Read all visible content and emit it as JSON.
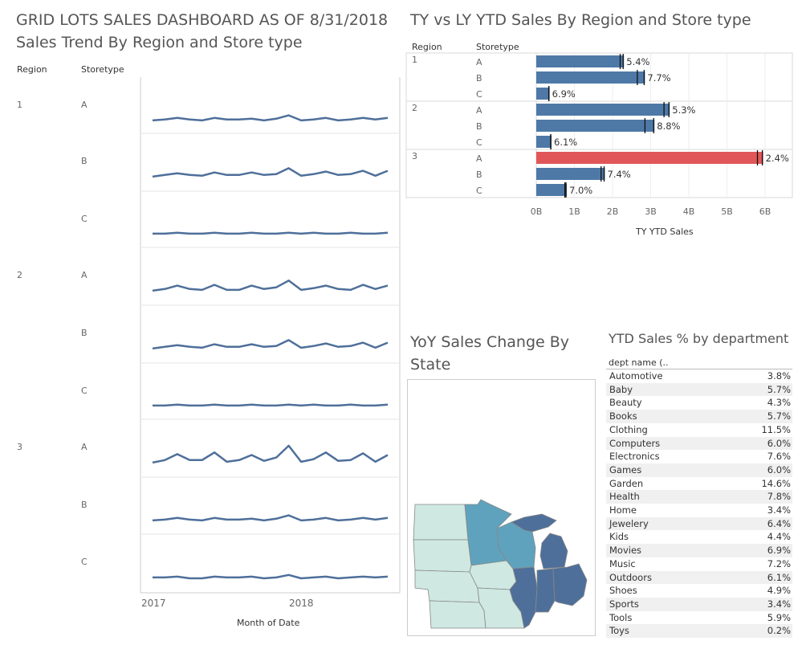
{
  "dashboard_title": "GRID LOTS SALES DASHBOARD AS OF 8/31/2018",
  "trend": {
    "title": "Sales Trend By Region and Store type",
    "region_header": "Region",
    "storetype_header": "Storetype",
    "xlabel": "Month of Date",
    "x_ticks": [
      "2017",
      "2018"
    ]
  },
  "ytd": {
    "title": "TY vs LY YTD Sales By Region and Store type",
    "region_header": "Region",
    "storetype_header": "Storetype",
    "xlabel": "TY YTD Sales",
    "x_ticks": [
      "0B",
      "1B",
      "2B",
      "3B",
      "4B",
      "5B",
      "6B"
    ]
  },
  "map": {
    "title": "YoY Sales Change By State"
  },
  "dept": {
    "title": "YTD Sales % by department",
    "column_header": "dept name (.."
  },
  "colors": {
    "bar": "#4e79a7",
    "highlight": "#e15759",
    "line": "#4e6f9a",
    "map_light": "#cfe8e1",
    "map_mid": "#5fa2bd",
    "map_dark": "#4e6f9a"
  },
  "chart_data": [
    {
      "type": "line",
      "title": "Sales Trend By Region and Store type",
      "xlabel": "Month of Date",
      "x_ticks": [
        "2017",
        "2018"
      ],
      "series": [
        {
          "region": "1",
          "storetype": "A",
          "values": [
            2,
            3,
            5,
            3,
            2,
            5,
            3,
            3,
            4,
            2,
            4,
            8,
            2,
            3,
            5,
            2,
            3,
            5,
            3,
            5
          ]
        },
        {
          "region": "1",
          "storetype": "B",
          "values": [
            2,
            4,
            6,
            4,
            3,
            7,
            4,
            4,
            7,
            4,
            5,
            12,
            3,
            5,
            8,
            4,
            5,
            9,
            3,
            9
          ]
        },
        {
          "region": "1",
          "storetype": "C",
          "values": [
            3,
            3,
            4,
            3,
            3,
            4,
            3,
            3,
            4,
            3,
            3,
            4,
            3,
            4,
            3,
            3,
            4,
            3,
            3,
            4
          ]
        },
        {
          "region": "2",
          "storetype": "A",
          "values": [
            2,
            4,
            8,
            4,
            3,
            9,
            3,
            3,
            8,
            4,
            6,
            14,
            3,
            5,
            8,
            4,
            3,
            9,
            4,
            8
          ]
        },
        {
          "region": "2",
          "storetype": "B",
          "values": [
            2,
            4,
            6,
            4,
            3,
            7,
            4,
            4,
            7,
            4,
            5,
            12,
            3,
            5,
            8,
            4,
            5,
            9,
            3,
            9
          ]
        },
        {
          "region": "2",
          "storetype": "C",
          "values": [
            3,
            3,
            4,
            3,
            3,
            4,
            3,
            3,
            4,
            3,
            3,
            4,
            3,
            4,
            3,
            3,
            4,
            3,
            3,
            4
          ]
        },
        {
          "region": "3",
          "storetype": "A",
          "values": [
            2,
            5,
            12,
            5,
            5,
            14,
            3,
            5,
            11,
            4,
            8,
            22,
            3,
            6,
            14,
            4,
            5,
            13,
            3,
            11
          ]
        },
        {
          "region": "3",
          "storetype": "B",
          "values": [
            2,
            3,
            5,
            3,
            2,
            5,
            3,
            3,
            4,
            2,
            4,
            8,
            2,
            3,
            5,
            2,
            3,
            5,
            3,
            5
          ]
        },
        {
          "region": "3",
          "storetype": "C",
          "values": [
            2,
            2,
            3,
            1,
            1,
            3,
            2,
            2,
            3,
            1,
            2,
            5,
            1,
            2,
            3,
            1,
            2,
            3,
            2,
            3
          ]
        }
      ]
    },
    {
      "type": "bar",
      "title": "TY vs LY YTD Sales By Region and Store type",
      "xlabel": "TY YTD Sales",
      "xlim": [
        0,
        6.4
      ],
      "unit": "B",
      "rows": [
        {
          "region": "1",
          "storetype": "A",
          "ty": 2.3,
          "ly": 2.2,
          "label": "5.4%",
          "highlight": false
        },
        {
          "region": "",
          "storetype": "B",
          "ty": 2.85,
          "ly": 2.65,
          "label": "7.7%",
          "highlight": false
        },
        {
          "region": "",
          "storetype": "C",
          "ty": 0.35,
          "ly": 0.33,
          "label": "6.9%",
          "highlight": false
        },
        {
          "region": "2",
          "storetype": "A",
          "ty": 3.5,
          "ly": 3.35,
          "label": "5.3%",
          "highlight": false
        },
        {
          "region": "",
          "storetype": "B",
          "ty": 3.1,
          "ly": 2.85,
          "label": "8.8%",
          "highlight": false
        },
        {
          "region": "",
          "storetype": "C",
          "ty": 0.4,
          "ly": 0.38,
          "label": "6.1%",
          "highlight": false
        },
        {
          "region": "3",
          "storetype": "A",
          "ty": 5.95,
          "ly": 5.8,
          "label": "2.4%",
          "highlight": true
        },
        {
          "region": "",
          "storetype": "B",
          "ty": 1.8,
          "ly": 1.7,
          "label": "7.4%",
          "highlight": false
        },
        {
          "region": "",
          "storetype": "C",
          "ty": 0.8,
          "ly": 0.75,
          "label": "7.0%",
          "highlight": false
        }
      ]
    },
    {
      "type": "table",
      "title": "YTD Sales % by department",
      "rows": [
        {
          "name": "Automotive",
          "value": "3.8%"
        },
        {
          "name": "Baby",
          "value": "5.7%"
        },
        {
          "name": "Beauty",
          "value": "4.3%"
        },
        {
          "name": "Books",
          "value": "5.7%"
        },
        {
          "name": "Clothing",
          "value": "11.5%"
        },
        {
          "name": "Computers",
          "value": "6.0%"
        },
        {
          "name": "Electronics",
          "value": "7.6%"
        },
        {
          "name": "Games",
          "value": "6.0%"
        },
        {
          "name": "Garden",
          "value": "14.6%"
        },
        {
          "name": "Health",
          "value": "7.8%"
        },
        {
          "name": "Home",
          "value": "3.4%"
        },
        {
          "name": "Jewelery",
          "value": "6.4%"
        },
        {
          "name": "Kids",
          "value": "4.4%"
        },
        {
          "name": "Movies",
          "value": "6.9%"
        },
        {
          "name": "Music",
          "value": "7.2%"
        },
        {
          "name": "Outdoors",
          "value": "6.1%"
        },
        {
          "name": "Shoes",
          "value": "4.9%"
        },
        {
          "name": "Sports",
          "value": "3.4%"
        },
        {
          "name": "Tools",
          "value": "5.9%"
        },
        {
          "name": "Toys",
          "value": "0.2%"
        }
      ]
    }
  ]
}
